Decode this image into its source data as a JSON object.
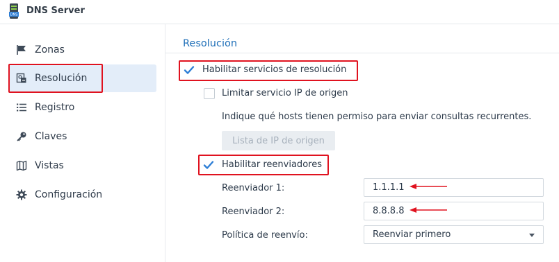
{
  "app": {
    "title": "DNS Server",
    "icon_text": "DNS"
  },
  "sidebar": {
    "items": [
      {
        "label": "Zonas",
        "icon": "flag-icon"
      },
      {
        "label": "Resolución",
        "icon": "resolution-icon"
      },
      {
        "label": "Registro",
        "icon": "list-icon"
      },
      {
        "label": "Claves",
        "icon": "key-icon"
      },
      {
        "label": "Vistas",
        "icon": "map-icon"
      },
      {
        "label": "Configuración",
        "icon": "gear-icon"
      }
    ],
    "selected": "Resolución"
  },
  "main": {
    "section_title": "Resolución",
    "enable_resolution": {
      "label": "Habilitar servicios de resolución",
      "checked": true
    },
    "limit_source_ip": {
      "label": "Limitar servicio IP de origen",
      "checked": false
    },
    "hint": "Indique qué hosts tienen permiso para enviar consultas recurrentes.",
    "source_ip_list_button": "Lista de IP de origen",
    "enable_forwarders": {
      "label": "Habilitar reenviadores",
      "checked": true
    },
    "forwarder1": {
      "label": "Reenviador 1:",
      "value": "1.1.1.1"
    },
    "forwarder2": {
      "label": "Reenviador 2:",
      "value": "8.8.8.8"
    },
    "forward_policy": {
      "label": "Política de reenvío:",
      "value": "Reenviar primero"
    }
  },
  "colors": {
    "accent": "#1f6fb8",
    "highlight_red": "#e0121f",
    "selected_bg": "#e3edf9",
    "check_blue": "#2d7ed6"
  }
}
